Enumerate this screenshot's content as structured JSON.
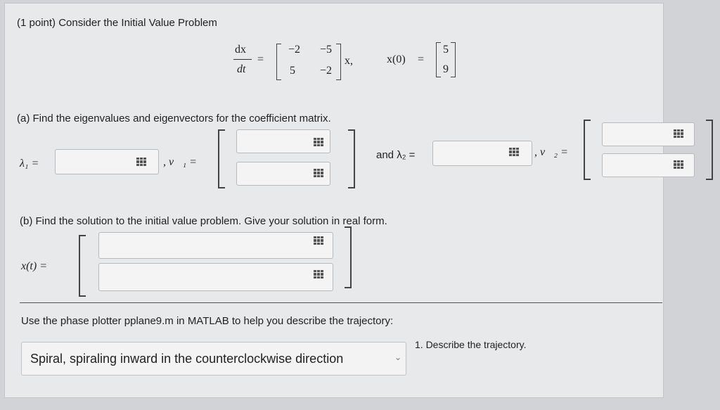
{
  "problem": {
    "header": "(1 point) Consider the Initial Value Problem",
    "ode_lhs_num": "dx",
    "ode_lhs_den": "dt",
    "equals": "=",
    "matrix": [
      "−2",
      "−5",
      "5",
      "−2"
    ],
    "x_suffix": "x,",
    "ic_label": "x(0)",
    "ic_vector": [
      "5",
      "9"
    ]
  },
  "part_a": {
    "prompt": "(a) Find the eigenvalues and eigenvectors for the coefficient matrix.",
    "lambda1_label": "λ₁ =",
    "v1_label": ", v⃗₁ =",
    "and_lambda2_label": "and λ₂ =",
    "v2_label": ", v⃗₂ =",
    "lambda1_value": "",
    "lambda2_value": "",
    "v1_values": [
      "",
      ""
    ],
    "v2_values": [
      "",
      ""
    ]
  },
  "part_b": {
    "prompt": "(b) Find the solution to the initial value problem. Give your solution in real form.",
    "xt_label": "x(t) =",
    "xt_values": [
      "",
      ""
    ]
  },
  "phase": {
    "prompt": "Use the phase plotter pplane9.m in MATLAB to help you describe the trajectory:",
    "selected_option": "Spiral, spiraling inward in the counterclockwise direction",
    "question_label": "1. Describe the trajectory."
  },
  "icons": {
    "math_palette": "grid-icon",
    "dropdown": "chevron-down-icon"
  }
}
